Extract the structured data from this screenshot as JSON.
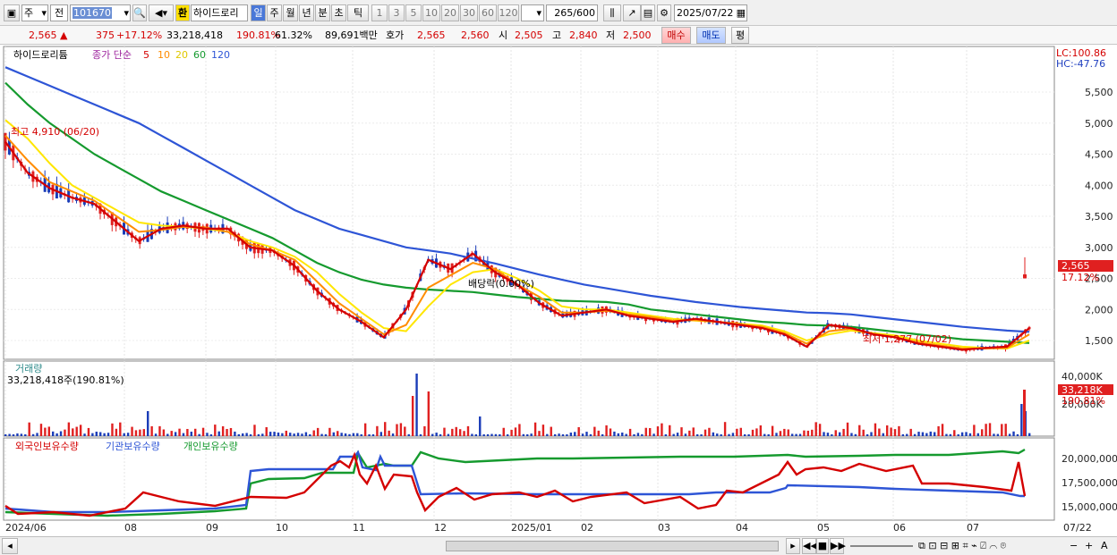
{
  "toolbar": {
    "period_type": "주",
    "market": "전",
    "code": "101670",
    "exchange_btn": "환",
    "stock_name": "하이드로리",
    "tabs": [
      "일",
      "주",
      "월",
      "년",
      "분",
      "초",
      "틱"
    ],
    "active_tab": "일",
    "intervals": [
      "1",
      "3",
      "5",
      "10",
      "20",
      "30",
      "60",
      "120"
    ],
    "count": "265",
    "count_max": "/600",
    "date": "2025/07/22"
  },
  "info": {
    "price": "2,565",
    "change": "375",
    "change_pct": "+17.12%",
    "volume": "33,218,418",
    "vol_ratio": "190.81%",
    "turnover_ratio": "61.32%",
    "amount": "89,691백만",
    "bid_label": "호가",
    "ask": "2,565",
    "bid": "2,560",
    "open_label": "시",
    "open": "2,505",
    "high_label": "고",
    "high": "2,840",
    "low_label": "저",
    "low": "2,500",
    "buy_btn": "매수",
    "sell_btn": "매도",
    "eval_btn": "평"
  },
  "price_panel": {
    "name": "하이드로리튬",
    "ma_label": "종가 단순",
    "ma_periods": [
      "5",
      "10",
      "20",
      "60",
      "120"
    ],
    "lc": "LC:100.86",
    "hc": "HC:-47.76",
    "high_note": "최고 4,910 (06/20)",
    "low_note": "최저 1,277 (07/02)",
    "mid_note": "배당락(0.00%)",
    "y_ticks": [
      "5,500",
      "5,000",
      "4,500",
      "4,000",
      "3,500",
      "3,000",
      "2,500",
      "2,000",
      "1,500"
    ],
    "last_price": "2,565",
    "last_pct": "17.12%"
  },
  "volume_panel": {
    "label": "거래량",
    "value": "33,218,418주(190.81%)",
    "y_ticks": [
      "40,000K",
      "20,000K"
    ],
    "last_value": "33,218K",
    "last_pct": "190.81%"
  },
  "holdings_panel": {
    "labels": [
      "외국인보유수량",
      "기관보유수량",
      "개인보유수량"
    ],
    "y_ticks": [
      "20,000,000",
      "17,500,000",
      "15,000,000"
    ]
  },
  "x_axis": [
    "2024/06",
    "08",
    "09",
    "10",
    "11",
    "12",
    "2025/01",
    "02",
    "03",
    "04",
    "05",
    "06",
    "07",
    "07/22"
  ],
  "colors": {
    "ma5": "#d40000",
    "ma10": "#ff8c00",
    "ma20": "#ffee00",
    "ma60": "#159a2e",
    "ma120": "#2e55d6",
    "up": "#e02020",
    "down": "#1a3cb8"
  },
  "chart_data": {
    "type": "line",
    "title": "",
    "x_label": "",
    "y_label": "",
    "x_range": [
      "2024/06",
      "2025/07/22"
    ],
    "y_range": [
      1000,
      5800
    ],
    "series": [
      {
        "name": "5",
        "values": [
          4700,
          4200,
          3950,
          3800,
          3700,
          3400,
          3100,
          3300,
          3350,
          3300,
          3300,
          3000,
          2950,
          2700,
          2300,
          2000,
          1800,
          1550,
          2000,
          2800,
          2650,
          2900,
          2600,
          2400,
          2100,
          1900,
          1950,
          2000,
          1900,
          1850,
          1800,
          1850,
          1800,
          1750,
          1700,
          1600,
          1400,
          1750,
          1700,
          1600,
          1550,
          1450,
          1400,
          1350,
          1380,
          1400,
          1700
        ]
      },
      {
        "name": "10",
        "values": [
          4800,
          4400,
          4050,
          3900,
          3750,
          3500,
          3250,
          3280,
          3330,
          3320,
          3250,
          3050,
          2950,
          2800,
          2450,
          2100,
          1850,
          1600,
          1750,
          2350,
          2550,
          2750,
          2650,
          2400,
          2200,
          1950,
          1950,
          1980,
          1920,
          1880,
          1820,
          1830,
          1800,
          1760,
          1720,
          1620,
          1450,
          1650,
          1690,
          1610,
          1550,
          1470,
          1420,
          1370,
          1370,
          1380,
          1600
        ]
      },
      {
        "name": "20",
        "values": [
          5050,
          4750,
          4350,
          4000,
          3800,
          3600,
          3400,
          3350,
          3330,
          3300,
          3250,
          3100,
          3000,
          2850,
          2600,
          2250,
          1950,
          1700,
          1650,
          2050,
          2400,
          2600,
          2650,
          2500,
          2300,
          2050,
          2000,
          2000,
          1950,
          1900,
          1850,
          1820,
          1800,
          1770,
          1740,
          1650,
          1500,
          1600,
          1660,
          1620,
          1580,
          1500,
          1450,
          1400,
          1380,
          1370,
          1500
        ]
      },
      {
        "name": "60",
        "values": [
          5650,
          5300,
          5000,
          4750,
          4500,
          4300,
          4100,
          3900,
          3750,
          3600,
          3450,
          3300,
          3150,
          2950,
          2750,
          2600,
          2480,
          2400,
          2350,
          2320,
          2300,
          2280,
          2240,
          2200,
          2170,
          2140,
          2130,
          2120,
          2080,
          2000,
          1960,
          1920,
          1880,
          1840,
          1800,
          1780,
          1750,
          1740,
          1720,
          1680,
          1640,
          1600,
          1560,
          1520,
          1500,
          1480,
          1460
        ]
      },
      {
        "name": "120",
        "values": [
          5900,
          5750,
          5600,
          5450,
          5300,
          5150,
          5000,
          4800,
          4600,
          4400,
          4200,
          4000,
          3800,
          3600,
          3450,
          3300,
          3200,
          3100,
          3000,
          2950,
          2900,
          2820,
          2740,
          2650,
          2560,
          2480,
          2400,
          2340,
          2280,
          2220,
          2170,
          2120,
          2080,
          2040,
          2010,
          1980,
          1950,
          1940,
          1920,
          1880,
          1840,
          1800,
          1760,
          1720,
          1690,
          1660,
          1640
        ]
      }
    ]
  }
}
